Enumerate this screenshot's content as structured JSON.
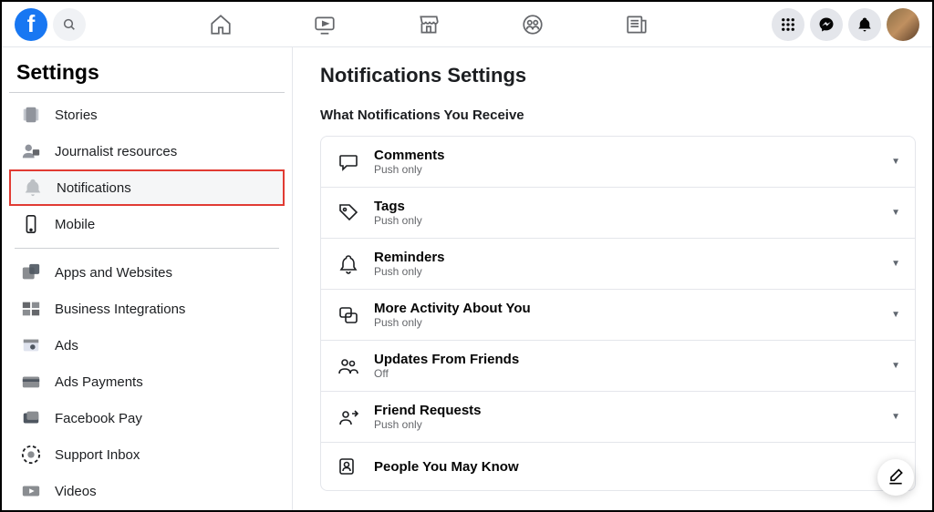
{
  "sidebar": {
    "title": "Settings",
    "items": [
      {
        "label": "Stories"
      },
      {
        "label": "Journalist resources"
      },
      {
        "label": "Notifications"
      },
      {
        "label": "Mobile"
      },
      {
        "label": "Apps and Websites"
      },
      {
        "label": "Business Integrations"
      },
      {
        "label": "Ads"
      },
      {
        "label": "Ads Payments"
      },
      {
        "label": "Facebook Pay"
      },
      {
        "label": "Support Inbox"
      },
      {
        "label": "Videos"
      }
    ]
  },
  "main": {
    "page_title": "Notifications Settings",
    "section_title": "What Notifications You Receive",
    "rows": [
      {
        "title": "Comments",
        "sub": "Push only"
      },
      {
        "title": "Tags",
        "sub": "Push only"
      },
      {
        "title": "Reminders",
        "sub": "Push only"
      },
      {
        "title": "More Activity About You",
        "sub": "Push only"
      },
      {
        "title": "Updates From Friends",
        "sub": "Off"
      },
      {
        "title": "Friend Requests",
        "sub": "Push only"
      },
      {
        "title": "People You May Know",
        "sub": ""
      }
    ]
  }
}
